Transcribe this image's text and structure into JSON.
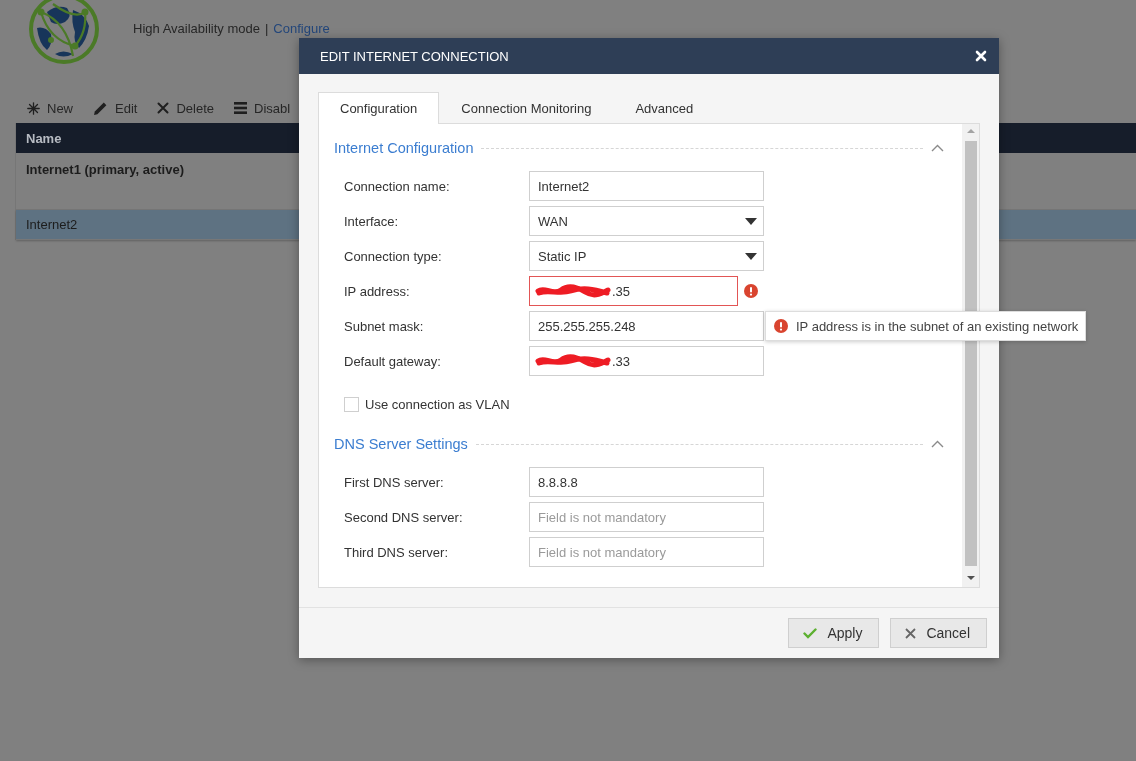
{
  "background": {
    "subtitle": "High Availability mode",
    "separator": "|",
    "link": "Configure",
    "toolbar": [
      {
        "kind": "new",
        "label": "New"
      },
      {
        "kind": "edit",
        "label": "Edit"
      },
      {
        "kind": "delete",
        "label": "Delete"
      },
      {
        "kind": "disable",
        "label": "Disabl"
      }
    ],
    "table": {
      "columns": [
        "Name"
      ],
      "rows": [
        {
          "name": "Internet1 (primary, active)",
          "active": true,
          "selected": false
        },
        {
          "name": "Internet2",
          "active": false,
          "selected": true
        }
      ]
    }
  },
  "dialog": {
    "title": "EDIT INTERNET CONNECTION",
    "tabs": [
      {
        "label": "Configuration",
        "selected": true
      },
      {
        "label": "Connection Monitoring",
        "selected": false
      },
      {
        "label": "Advanced",
        "selected": false
      }
    ],
    "sections": [
      {
        "title": "Internet Configuration",
        "expanded": true,
        "fields": [
          {
            "kind": "text",
            "label": "Connection name:",
            "value": "Internet2",
            "error": false,
            "redacted": false
          },
          {
            "kind": "select",
            "label": "Interface:",
            "value": "WAN",
            "error": false,
            "redacted": false
          },
          {
            "kind": "select",
            "label": "Connection type:",
            "value": "Static IP",
            "error": false,
            "redacted": false
          },
          {
            "kind": "text",
            "label": "IP address:",
            "value": ".35",
            "error": true,
            "redacted": true
          },
          {
            "kind": "text",
            "label": "Subnet mask:",
            "value": "255.255.255.248",
            "error": false,
            "redacted": false
          },
          {
            "kind": "text",
            "label": "Default gateway:",
            "value": ".33",
            "error": false,
            "redacted": true
          }
        ],
        "options": [
          {
            "label": "Use connection as VLAN",
            "checked": false
          }
        ]
      },
      {
        "title": "DNS Server Settings",
        "expanded": true,
        "fields": [
          {
            "kind": "text",
            "label": "First DNS server:",
            "value": "8.8.8.8",
            "error": false,
            "redacted": false
          },
          {
            "kind": "text",
            "label": "Second DNS server:",
            "placeholder": "Field is not mandatory",
            "error": false,
            "redacted": false
          },
          {
            "kind": "text",
            "label": "Third DNS server:",
            "placeholder": "Field is not mandatory",
            "error": false,
            "redacted": false
          }
        ]
      }
    ],
    "tooltip": {
      "text": "IP address is in the subnet of an existing network"
    },
    "buttons": [
      {
        "kind": "apply",
        "label": "Apply"
      },
      {
        "kind": "cancel",
        "label": "Cancel"
      }
    ]
  }
}
